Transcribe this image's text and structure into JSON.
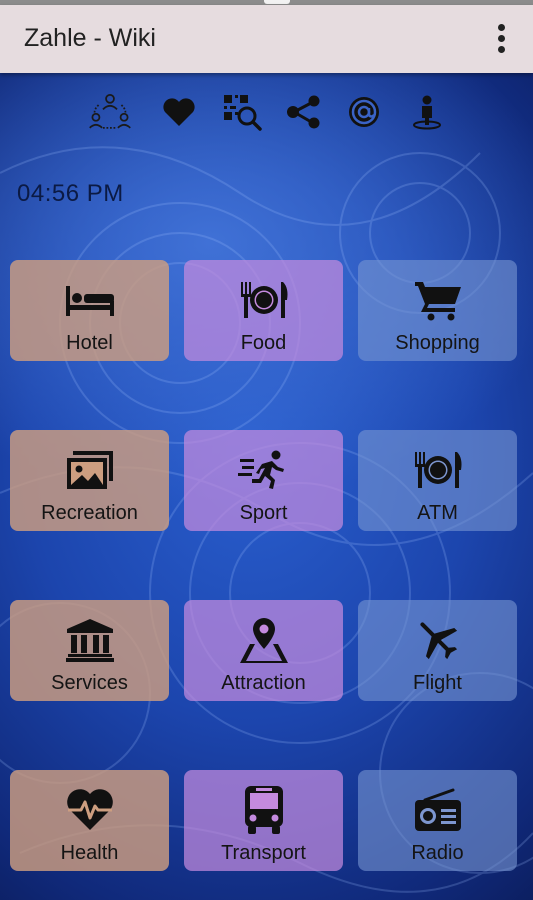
{
  "app": {
    "title": "Zahle - Wiki"
  },
  "iconbar": [
    "share-people-icon",
    "heart-icon",
    "qr-scan-icon",
    "share-icon",
    "at-sign-icon",
    "person-pin-icon"
  ],
  "clock": "04:56 PM",
  "tiles": [
    {
      "label": "Hotel",
      "icon": "bed-icon"
    },
    {
      "label": "Food",
      "icon": "dining-icon"
    },
    {
      "label": "Shopping",
      "icon": "cart-icon"
    },
    {
      "label": "Recreation",
      "icon": "photos-icon"
    },
    {
      "label": "Sport",
      "icon": "running-icon"
    },
    {
      "label": "ATM",
      "icon": "dining-icon"
    },
    {
      "label": "Services",
      "icon": "bank-icon"
    },
    {
      "label": "Attraction",
      "icon": "map-pin-icon"
    },
    {
      "label": "Flight",
      "icon": "airplane-icon"
    },
    {
      "label": "Health",
      "icon": "heartbeat-icon"
    },
    {
      "label": "Transport",
      "icon": "bus-icon"
    },
    {
      "label": "Radio",
      "icon": "radio-icon"
    }
  ],
  "colors": {
    "appbar": "#e6dcdf",
    "tile_col1": "#cd9e80",
    "tile_col2": "#c48ade",
    "tile_col3": "#7896d2",
    "icon": "#111111"
  }
}
